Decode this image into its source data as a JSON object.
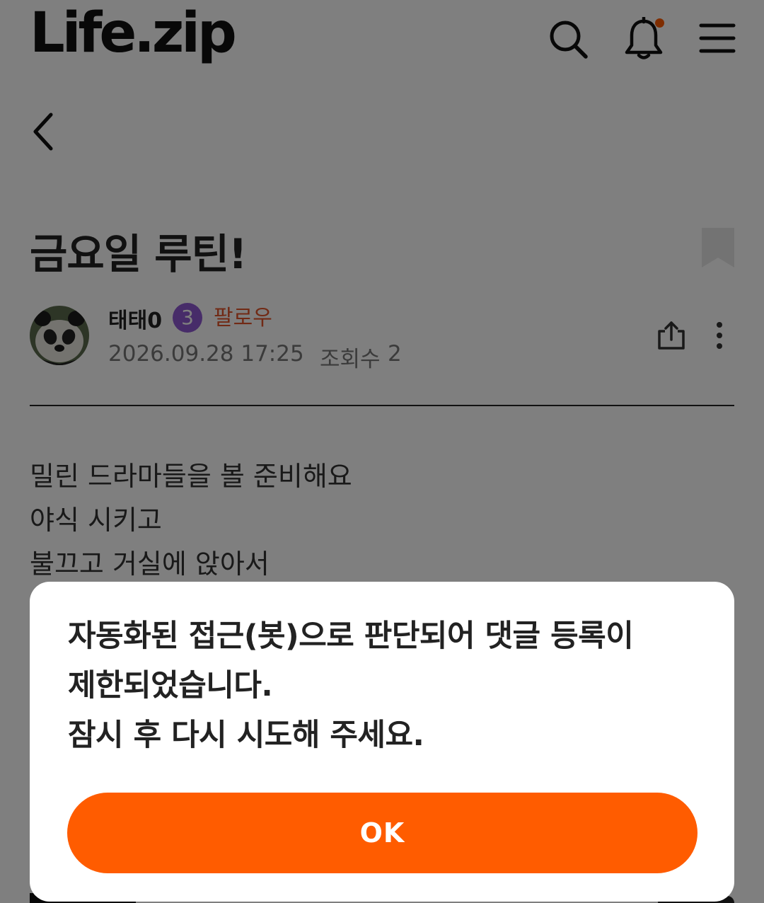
{
  "header": {
    "logo_text": "Life.zip",
    "icons": [
      "search-icon",
      "bell-icon",
      "hamburger-menu-icon"
    ],
    "notification_dot_color": "#ff5a00"
  },
  "post": {
    "title": "금요일 루틴!",
    "author": {
      "name": "태태0",
      "level": "3",
      "level_badge_color": "#8f58d2",
      "follow_label": "팔로우",
      "follow_color": "#e3552a"
    },
    "date": "2026.09.28 17:25",
    "views_label": "조회수",
    "views_count": "2",
    "body_lines": [
      "밀린 드라마들을 볼 준비해요",
      "야식 시키고",
      "불끄고 거실에 앉아서"
    ]
  },
  "dialog": {
    "message_lines": [
      "자동화된 접근(봇)으로 판단되어 댓글 등록이",
      "제한되었습니다.",
      "잠시 후 다시 시도해 주세요."
    ],
    "ok_label": "OK",
    "ok_color": "#ff5c00"
  }
}
